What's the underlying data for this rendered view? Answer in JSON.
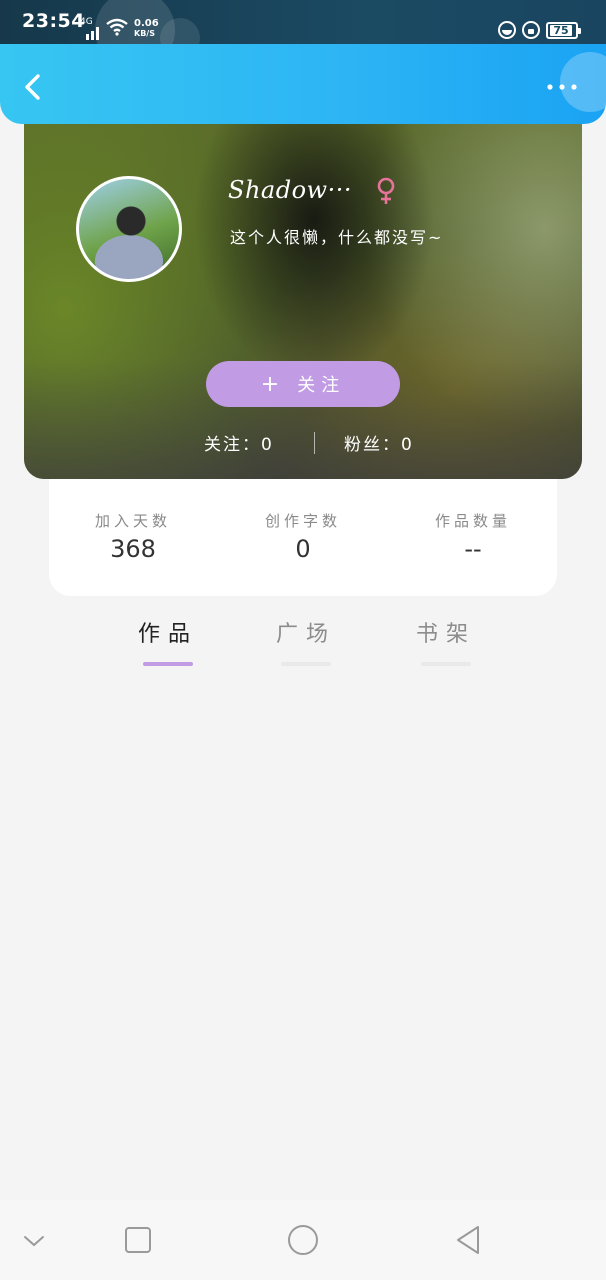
{
  "status_bar": {
    "time": "23:54",
    "network": "4G",
    "speed_value": "0.06",
    "speed_unit": "KB/S",
    "battery": "75"
  },
  "header": {
    "back_icon": "chevron-left-icon",
    "more_icon": "more-horizontal-icon"
  },
  "profile": {
    "username": "Shadow···",
    "gender_icon": "female-icon",
    "bio": "这个人很懒，什么都没写~",
    "follow_plus": "+",
    "follow_label": "关注",
    "following_label": "关注：",
    "following_count": "0",
    "fans_label": "粉丝：",
    "fans_count": "0",
    "accent_color": "#c19ce5",
    "gender_color": "#e8739a"
  },
  "stats": [
    {
      "label": "加入天数",
      "value": "368"
    },
    {
      "label": "创作字数",
      "value": "0"
    },
    {
      "label": "作品数量",
      "value": "--"
    }
  ],
  "tabs": [
    {
      "label": "作品",
      "active": true
    },
    {
      "label": "广场",
      "active": false
    },
    {
      "label": "书架",
      "active": false
    }
  ],
  "nav_bar": {
    "icons": [
      "chevron-down-icon",
      "square-icon",
      "circle-icon",
      "triangle-back-icon"
    ]
  }
}
